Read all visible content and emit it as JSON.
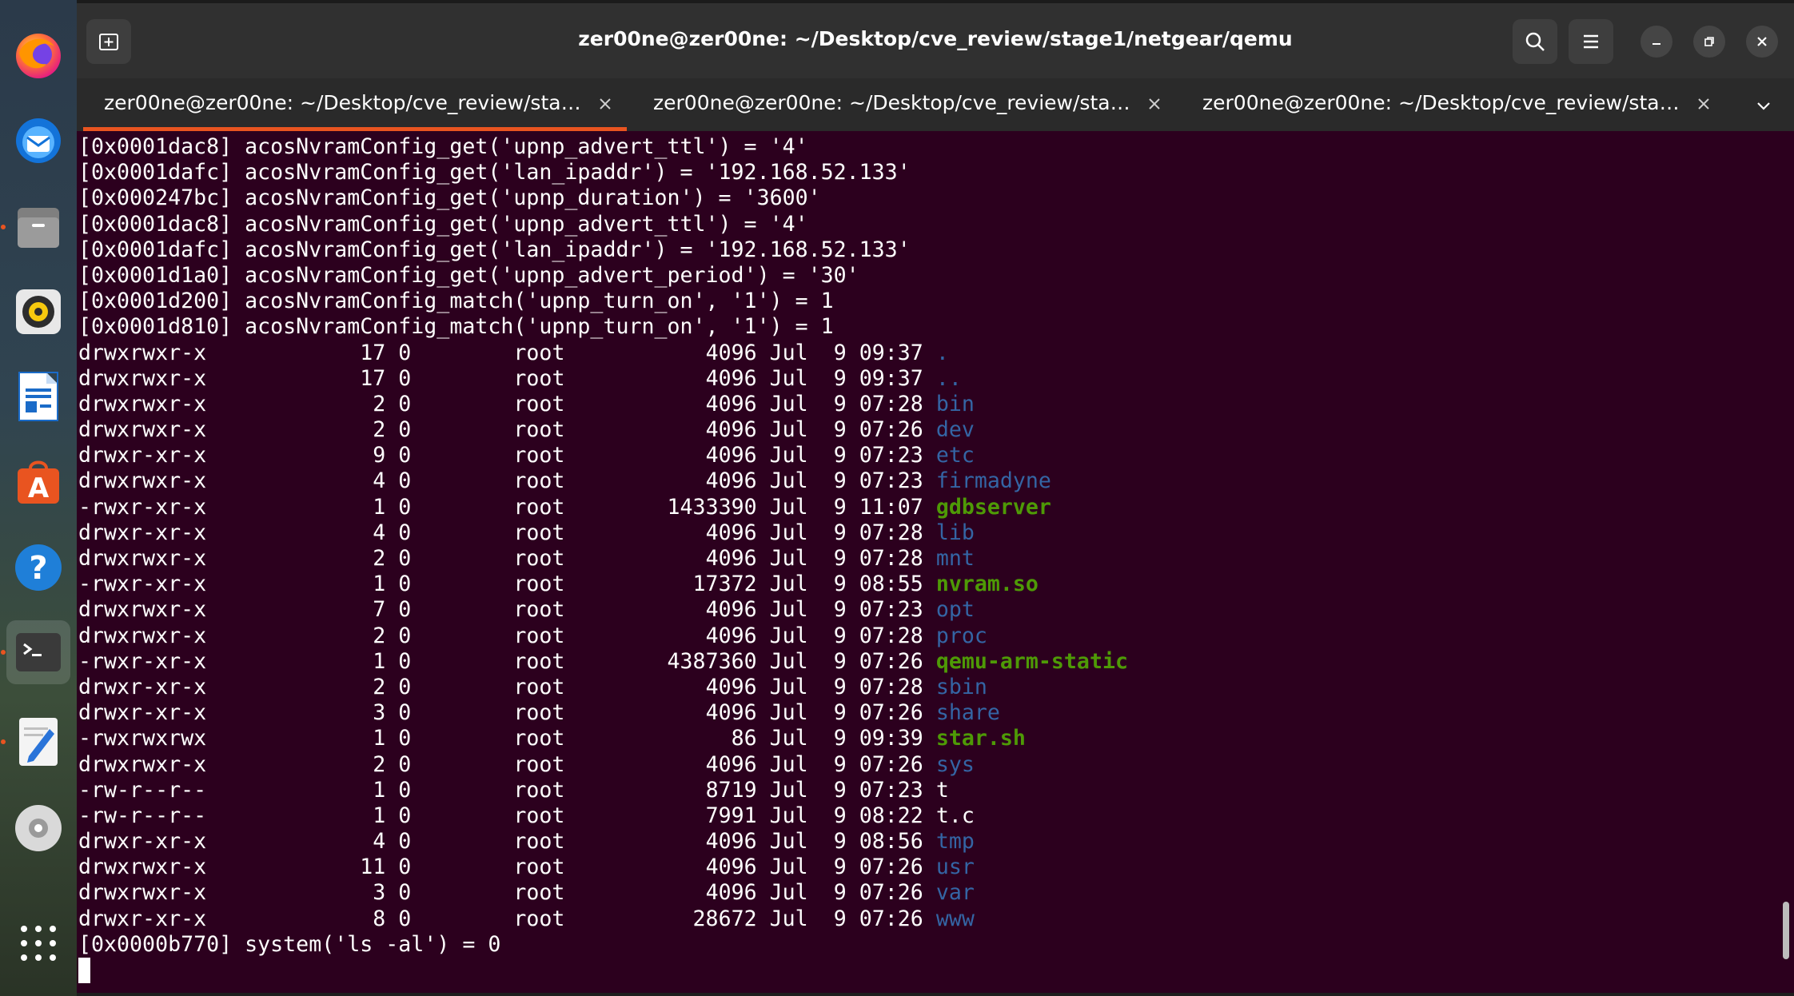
{
  "window": {
    "title": "zer00ne@zer00ne: ~/Desktop/cve_review/stage1/netgear/qemu"
  },
  "dock": {
    "items": [
      {
        "name": "firefox",
        "icon": "firefox-icon",
        "running": false
      },
      {
        "name": "thunderbird",
        "icon": "thunderbird-icon",
        "running": false
      },
      {
        "name": "files",
        "icon": "files-icon",
        "running": true
      },
      {
        "name": "rhythmbox",
        "icon": "rhythmbox-icon",
        "running": false
      },
      {
        "name": "writer",
        "icon": "writer-icon",
        "running": false
      },
      {
        "name": "software",
        "icon": "software-icon",
        "running": false
      },
      {
        "name": "help",
        "icon": "help-icon",
        "running": false
      },
      {
        "name": "terminal",
        "icon": "terminal-icon",
        "running": true
      },
      {
        "name": "text-editor",
        "icon": "text-editor-icon",
        "running": true
      },
      {
        "name": "disc",
        "icon": "disc-icon",
        "running": false
      },
      {
        "name": "show-apps",
        "icon": "app-grid-icon",
        "running": false
      }
    ]
  },
  "tabs": [
    {
      "label": "zer00ne@zer00ne: ~/Desktop/cve_review/stage1/netgear/qemu",
      "active": true
    },
    {
      "label": "zer00ne@zer00ne: ~/Desktop/cve_review/stage1/netgear/qemu",
      "active": false
    },
    {
      "label": "zer00ne@zer00ne: ~/Desktop/cve_review/stage1/netgear/qemu",
      "active": false
    }
  ],
  "colors": {
    "terminal_bg": "#2c001e",
    "directory": "#3465a4",
    "executable": "#4e9a06",
    "accent": "#e95420"
  },
  "terminal": {
    "log_lines": [
      "[0x0001dac8] acosNvramConfig_get('upnp_advert_ttl') = '4'",
      "[0x0001dafc] acosNvramConfig_get('lan_ipaddr') = '192.168.52.133'",
      "[0x000247bc] acosNvramConfig_get('upnp_duration') = '3600'",
      "[0x0001dac8] acosNvramConfig_get('upnp_advert_ttl') = '4'",
      "[0x0001dafc] acosNvramConfig_get('lan_ipaddr') = '192.168.52.133'",
      "[0x0001d1a0] acosNvramConfig_get('upnp_advert_period') = '30'",
      "[0x0001d200] acosNvramConfig_match('upnp_turn_on', '1') = 1",
      "[0x0001d810] acosNvramConfig_match('upnp_turn_on', '1') = 1"
    ],
    "listing": [
      {
        "perms": "drwxrwxr-x",
        "links": "17",
        "uid": "0",
        "owner": "root",
        "size": "4096",
        "month": "Jul",
        "day": "9",
        "time": "09:37",
        "name": ".",
        "kind": "dir"
      },
      {
        "perms": "drwxrwxr-x",
        "links": "17",
        "uid": "0",
        "owner": "root",
        "size": "4096",
        "month": "Jul",
        "day": "9",
        "time": "09:37",
        "name": "..",
        "kind": "dir"
      },
      {
        "perms": "drwxrwxr-x",
        "links": "2",
        "uid": "0",
        "owner": "root",
        "size": "4096",
        "month": "Jul",
        "day": "9",
        "time": "07:28",
        "name": "bin",
        "kind": "dir"
      },
      {
        "perms": "drwxrwxr-x",
        "links": "2",
        "uid": "0",
        "owner": "root",
        "size": "4096",
        "month": "Jul",
        "day": "9",
        "time": "07:26",
        "name": "dev",
        "kind": "dir"
      },
      {
        "perms": "drwxr-xr-x",
        "links": "9",
        "uid": "0",
        "owner": "root",
        "size": "4096",
        "month": "Jul",
        "day": "9",
        "time": "07:23",
        "name": "etc",
        "kind": "dir"
      },
      {
        "perms": "drwxrwxr-x",
        "links": "4",
        "uid": "0",
        "owner": "root",
        "size": "4096",
        "month": "Jul",
        "day": "9",
        "time": "07:23",
        "name": "firmadyne",
        "kind": "dir"
      },
      {
        "perms": "-rwxr-xr-x",
        "links": "1",
        "uid": "0",
        "owner": "root",
        "size": "1433390",
        "month": "Jul",
        "day": "9",
        "time": "11:07",
        "name": "gdbserver",
        "kind": "exe"
      },
      {
        "perms": "drwxr-xr-x",
        "links": "4",
        "uid": "0",
        "owner": "root",
        "size": "4096",
        "month": "Jul",
        "day": "9",
        "time": "07:28",
        "name": "lib",
        "kind": "dir"
      },
      {
        "perms": "drwxrwxr-x",
        "links": "2",
        "uid": "0",
        "owner": "root",
        "size": "4096",
        "month": "Jul",
        "day": "9",
        "time": "07:28",
        "name": "mnt",
        "kind": "dir"
      },
      {
        "perms": "-rwxr-xr-x",
        "links": "1",
        "uid": "0",
        "owner": "root",
        "size": "17372",
        "month": "Jul",
        "day": "9",
        "time": "08:55",
        "name": "nvram.so",
        "kind": "exe"
      },
      {
        "perms": "drwxrwxr-x",
        "links": "7",
        "uid": "0",
        "owner": "root",
        "size": "4096",
        "month": "Jul",
        "day": "9",
        "time": "07:23",
        "name": "opt",
        "kind": "dir"
      },
      {
        "perms": "drwxrwxr-x",
        "links": "2",
        "uid": "0",
        "owner": "root",
        "size": "4096",
        "month": "Jul",
        "day": "9",
        "time": "07:28",
        "name": "proc",
        "kind": "dir"
      },
      {
        "perms": "-rwxr-xr-x",
        "links": "1",
        "uid": "0",
        "owner": "root",
        "size": "4387360",
        "month": "Jul",
        "day": "9",
        "time": "07:26",
        "name": "qemu-arm-static",
        "kind": "exe"
      },
      {
        "perms": "drwxr-xr-x",
        "links": "2",
        "uid": "0",
        "owner": "root",
        "size": "4096",
        "month": "Jul",
        "day": "9",
        "time": "07:28",
        "name": "sbin",
        "kind": "dir"
      },
      {
        "perms": "drwxr-xr-x",
        "links": "3",
        "uid": "0",
        "owner": "root",
        "size": "4096",
        "month": "Jul",
        "day": "9",
        "time": "07:26",
        "name": "share",
        "kind": "dir"
      },
      {
        "perms": "-rwxrwxrwx",
        "links": "1",
        "uid": "0",
        "owner": "root",
        "size": "86",
        "month": "Jul",
        "day": "9",
        "time": "09:39",
        "name": "star.sh",
        "kind": "exe"
      },
      {
        "perms": "drwxrwxr-x",
        "links": "2",
        "uid": "0",
        "owner": "root",
        "size": "4096",
        "month": "Jul",
        "day": "9",
        "time": "07:26",
        "name": "sys",
        "kind": "dir"
      },
      {
        "perms": "-rw-r--r--",
        "links": "1",
        "uid": "0",
        "owner": "root",
        "size": "8719",
        "month": "Jul",
        "day": "9",
        "time": "07:23",
        "name": "t",
        "kind": "file"
      },
      {
        "perms": "-rw-r--r--",
        "links": "1",
        "uid": "0",
        "owner": "root",
        "size": "7991",
        "month": "Jul",
        "day": "9",
        "time": "08:22",
        "name": "t.c",
        "kind": "file"
      },
      {
        "perms": "drwxr-xr-x",
        "links": "4",
        "uid": "0",
        "owner": "root",
        "size": "4096",
        "month": "Jul",
        "day": "9",
        "time": "08:56",
        "name": "tmp",
        "kind": "dir"
      },
      {
        "perms": "drwxrwxr-x",
        "links": "11",
        "uid": "0",
        "owner": "root",
        "size": "4096",
        "month": "Jul",
        "day": "9",
        "time": "07:26",
        "name": "usr",
        "kind": "dir"
      },
      {
        "perms": "drwxrwxr-x",
        "links": "3",
        "uid": "0",
        "owner": "root",
        "size": "4096",
        "month": "Jul",
        "day": "9",
        "time": "07:26",
        "name": "var",
        "kind": "dir"
      },
      {
        "perms": "drwxr-xr-x",
        "links": "8",
        "uid": "0",
        "owner": "root",
        "size": "28672",
        "month": "Jul",
        "day": "9",
        "time": "07:26",
        "name": "www",
        "kind": "dir"
      }
    ],
    "final_line": "[0x0000b770] system('ls -al') = 0"
  }
}
